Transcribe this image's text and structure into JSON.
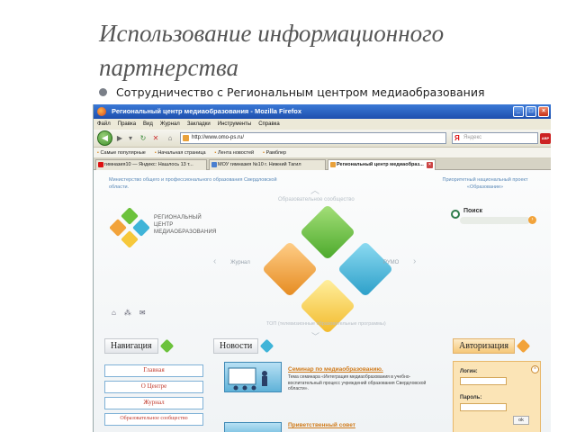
{
  "slide": {
    "title": "Использование информационного партнерства",
    "bullet": "Сотрудничество с Региональным центром медиаобразования"
  },
  "browser": {
    "window_title": "Региональный центр медиаобразования - Mozilla Firefox",
    "menu": [
      "Файл",
      "Правка",
      "Вид",
      "Журнал",
      "Закладки",
      "Инструменты",
      "Справка"
    ],
    "url": "http://www.omo-ps.ru/",
    "search_placeholder": "Яндекс",
    "search_logo": "Я",
    "addon_label": "ABP",
    "bookmarks": [
      "Самые популярные",
      "Начальная страница",
      "Лента новостей",
      "Рамблер"
    ],
    "tabs": [
      {
        "label": "гимназия10 — Яндекс: Нашлось 13 т...",
        "active": false
      },
      {
        "label": "МОУ гимназия №10 г. Нижний Тагил",
        "active": false
      },
      {
        "label": "Региональный центр медиаобраз...",
        "active": true
      }
    ],
    "icons": {
      "back": "back-arrow-icon",
      "forward": "forward-arrow-icon",
      "reload": "reload-icon",
      "stop": "stop-icon",
      "home": "home-icon"
    }
  },
  "site": {
    "ministry": "Министерство общего и профессионального образования Свердловской области.",
    "community_label": "Образовательное сообщество",
    "project": "Приоритетный национальный проект «Образование»",
    "logo_text": [
      "РЕГИОНАЛЬНЫЙ",
      "ЦЕНТР",
      "МЕДИАОБРАЗОВАНИЯ"
    ],
    "search_label": "Поиск",
    "left_label": "Журнал",
    "right_label": "РУМО",
    "top_label": "ТОП (телевизионные образовательные программы)",
    "colors": {
      "green": "#6cc23c",
      "blue": "#3fb4d8",
      "yellow": "#f6c83a",
      "orange": "#f2a33a"
    },
    "columns": {
      "nav": "Навигация",
      "news": "Новости",
      "auth": "Авторизация"
    },
    "nav_items": [
      "Главная",
      "О Центре",
      "Журнал",
      "Образовательное сообщество"
    ],
    "news": [
      {
        "title": "Семинар по медиаобразованию.",
        "text": "Тема семинара «Интеграция медиаобразования в учебно-воспитательный процесс учреждений образования Свердловской области»."
      },
      {
        "title": "Приветственный совет",
        "text": ""
      }
    ],
    "auth": {
      "login_label": "Логин:",
      "password_label": "Пароль:",
      "ok": "ok"
    }
  }
}
